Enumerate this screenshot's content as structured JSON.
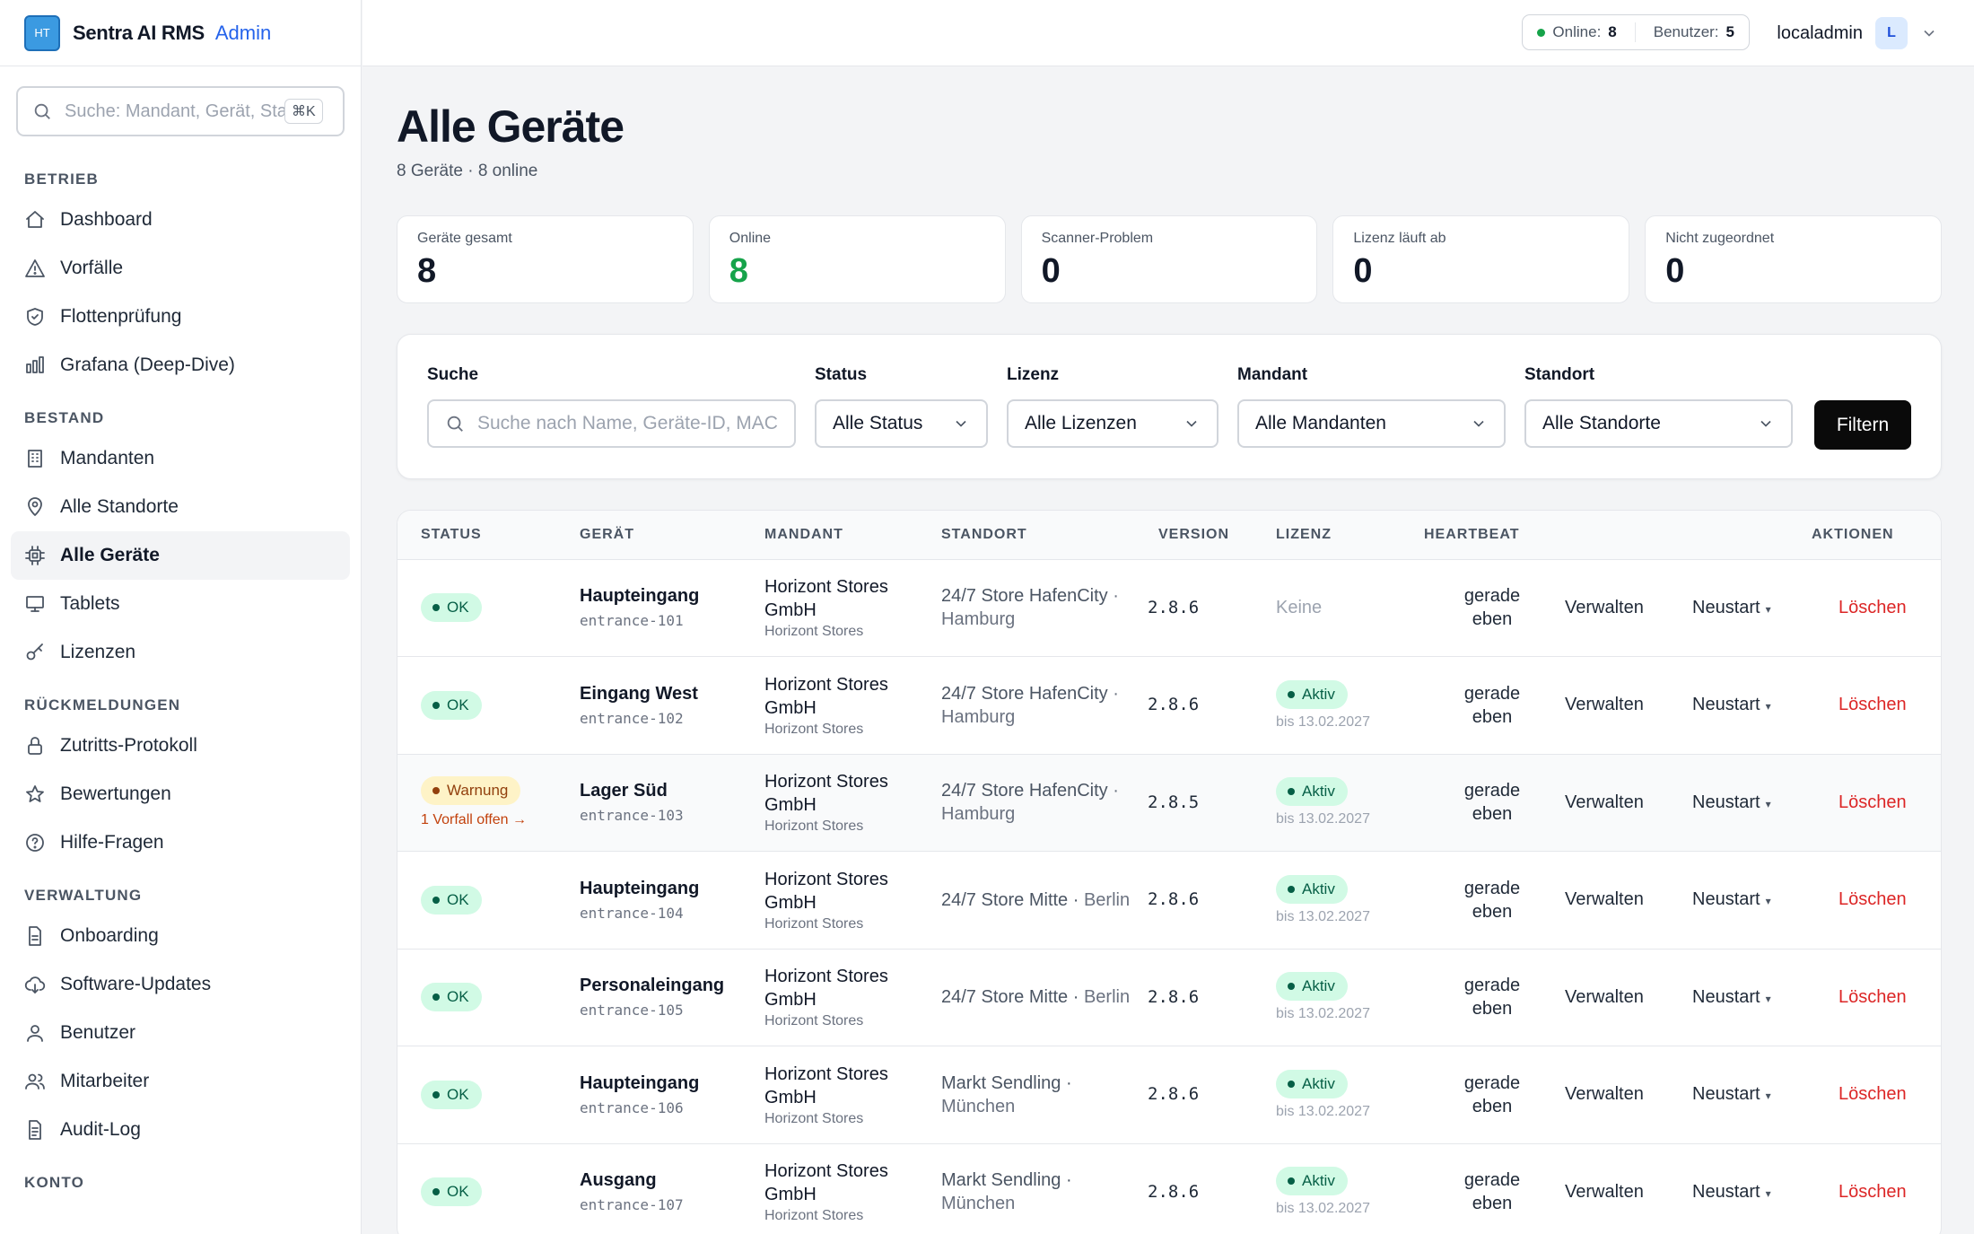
{
  "brand": {
    "logo": "HT",
    "name": "Sentra AI RMS",
    "role": "Admin"
  },
  "sidebar": {
    "search_placeholder": "Suche: Mandant, Gerät, Standort …",
    "shortcut": "⌘K",
    "sections": [
      {
        "title": "BETRIEB",
        "items": [
          {
            "label": "Dashboard",
            "icon": "home-icon"
          },
          {
            "label": "Vorfälle",
            "icon": "warning-icon"
          },
          {
            "label": "Flottenprüfung",
            "icon": "shield-icon"
          },
          {
            "label": "Grafana (Deep-Dive)",
            "icon": "bar-chart-icon"
          }
        ]
      },
      {
        "title": "BESTAND",
        "items": [
          {
            "label": "Mandanten",
            "icon": "building-icon"
          },
          {
            "label": "Alle Standorte",
            "icon": "map-pin-icon"
          },
          {
            "label": "Alle Geräte",
            "icon": "chip-icon",
            "active": true
          },
          {
            "label": "Tablets",
            "icon": "monitor-icon"
          },
          {
            "label": "Lizenzen",
            "icon": "key-icon"
          }
        ]
      },
      {
        "title": "RÜCKMELDUNGEN",
        "items": [
          {
            "label": "Zutritts-Protokoll",
            "icon": "lock-icon"
          },
          {
            "label": "Bewertungen",
            "icon": "star-icon"
          },
          {
            "label": "Hilfe-Fragen",
            "icon": "help-icon"
          }
        ]
      },
      {
        "title": "VERWALTUNG",
        "items": [
          {
            "label": "Onboarding",
            "icon": "file-icon"
          },
          {
            "label": "Software-Updates",
            "icon": "cloud-download-icon"
          },
          {
            "label": "Benutzer",
            "icon": "user-icon"
          },
          {
            "label": "Mitarbeiter",
            "icon": "users-icon"
          },
          {
            "label": "Audit-Log",
            "icon": "document-icon"
          }
        ]
      },
      {
        "title": "KONTO",
        "items": []
      }
    ]
  },
  "header": {
    "online_label": "Online:",
    "online_count": "8",
    "users_label": "Benutzer:",
    "users_count": "5",
    "username": "localadmin",
    "avatar_letter": "L"
  },
  "page": {
    "title": "Alle Geräte",
    "subtitle": "8 Geräte · 8 online"
  },
  "cards": [
    {
      "label": "Geräte gesamt",
      "value": "8",
      "accent": false
    },
    {
      "label": "Online",
      "value": "8",
      "accent": true
    },
    {
      "label": "Scanner-Problem",
      "value": "0",
      "accent": false
    },
    {
      "label": "Lizenz läuft ab",
      "value": "0",
      "accent": false
    },
    {
      "label": "Nicht zugeordnet",
      "value": "0",
      "accent": false
    }
  ],
  "filters": {
    "search_label": "Suche",
    "search_placeholder": "Suche nach Name, Geräte-ID, MAC, …",
    "status_label": "Status",
    "status_value": "Alle Status",
    "license_label": "Lizenz",
    "license_value": "Alle Lizenzen",
    "tenant_label": "Mandant",
    "tenant_value": "Alle Mandanten",
    "location_label": "Standort",
    "location_value": "Alle Standorte",
    "submit": "Filtern"
  },
  "table": {
    "headers": [
      "STATUS",
      "GERÄT",
      "MANDANT",
      "STANDORT",
      "VERSION",
      "LIZENZ",
      "HEARTBEAT",
      "",
      "",
      "AKTIONEN"
    ],
    "actions": {
      "manage": "Verwalten",
      "restart": "Neustart",
      "restart_caret": "▾",
      "delete": "Löschen"
    },
    "rows": [
      {
        "status": "OK",
        "status_type": "ok",
        "incident": "",
        "name": "Haupteingang",
        "id": "entrance-101",
        "tenant": "Horizont Stores GmbH",
        "tenant_sub": "Horizont Stores",
        "loc_main": "24/7 Store HafenCity",
        "loc_city": "· Hamburg",
        "version": "2.8.6",
        "license": "Keine",
        "license_type": "none",
        "license_until": "",
        "heartbeat": "gerade eben"
      },
      {
        "status": "OK",
        "status_type": "ok",
        "incident": "",
        "name": "Eingang West",
        "id": "entrance-102",
        "tenant": "Horizont Stores GmbH",
        "tenant_sub": "Horizont Stores",
        "loc_main": "24/7 Store HafenCity",
        "loc_city": "· Hamburg",
        "version": "2.8.6",
        "license": "Aktiv",
        "license_type": "active",
        "license_until": "bis 13.02.2027",
        "heartbeat": "gerade eben"
      },
      {
        "status": "Warnung",
        "status_type": "warn",
        "incident": "1 Vorfall offen →",
        "name": "Lager Süd",
        "id": "entrance-103",
        "tenant": "Horizont Stores GmbH",
        "tenant_sub": "Horizont Stores",
        "loc_main": "24/7 Store HafenCity",
        "loc_city": "· Hamburg",
        "version": "2.8.5",
        "license": "Aktiv",
        "license_type": "active",
        "license_until": "bis 13.02.2027",
        "heartbeat": "gerade eben"
      },
      {
        "status": "OK",
        "status_type": "ok",
        "incident": "",
        "name": "Haupteingang",
        "id": "entrance-104",
        "tenant": "Horizont Stores GmbH",
        "tenant_sub": "Horizont Stores",
        "loc_main": "24/7 Store Mitte ·",
        "loc_city": "Berlin",
        "version": "2.8.6",
        "license": "Aktiv",
        "license_type": "active",
        "license_until": "bis 13.02.2027",
        "heartbeat": "gerade eben"
      },
      {
        "status": "OK",
        "status_type": "ok",
        "incident": "",
        "name": "Personaleingang",
        "id": "entrance-105",
        "tenant": "Horizont Stores GmbH",
        "tenant_sub": "Horizont Stores",
        "loc_main": "24/7 Store Mitte ·",
        "loc_city": "Berlin",
        "version": "2.8.6",
        "license": "Aktiv",
        "license_type": "active",
        "license_until": "bis 13.02.2027",
        "heartbeat": "gerade eben"
      },
      {
        "status": "OK",
        "status_type": "ok",
        "incident": "",
        "name": "Haupteingang",
        "id": "entrance-106",
        "tenant": "Horizont Stores GmbH",
        "tenant_sub": "Horizont Stores",
        "loc_main": "Markt Sendling ·",
        "loc_city": "München",
        "version": "2.8.6",
        "license": "Aktiv",
        "license_type": "active",
        "license_until": "bis 13.02.2027",
        "heartbeat": "gerade eben"
      },
      {
        "status": "OK",
        "status_type": "ok",
        "incident": "",
        "name": "Ausgang",
        "id": "entrance-107",
        "tenant": "Horizont Stores GmbH",
        "tenant_sub": "Horizont Stores",
        "loc_main": "Markt Sendling ·",
        "loc_city": "München",
        "version": "2.8.6",
        "license": "Aktiv",
        "license_type": "active",
        "license_until": "bis 13.02.2027",
        "heartbeat": "gerade eben"
      }
    ]
  },
  "colors": {
    "accent_blue": "#2563eb",
    "online_green": "#16a34a",
    "danger_red": "#dc2626",
    "warning_bg": "#fef3c7"
  }
}
